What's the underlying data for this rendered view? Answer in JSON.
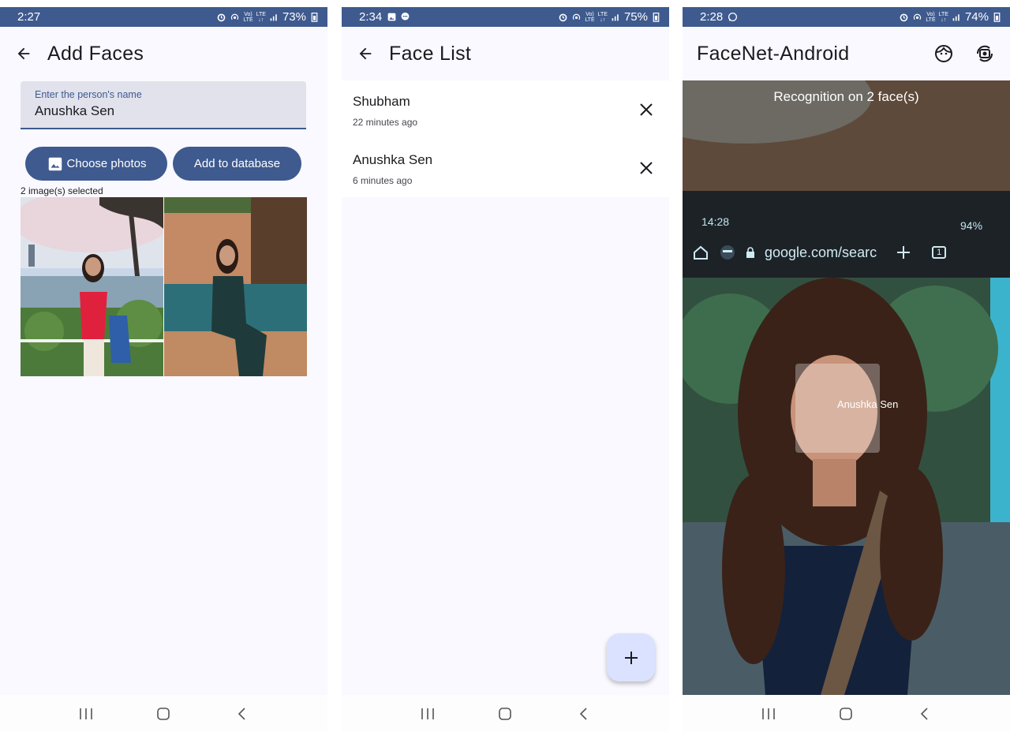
{
  "screen1": {
    "status": {
      "time": "2:27",
      "battery": "73%"
    },
    "title": "Add Faces",
    "name_field": {
      "label": "Enter the person's name",
      "value": "Anushka Sen"
    },
    "choose_label": "Choose photos",
    "add_label": "Add to database",
    "selected_text": "2 image(s) selected"
  },
  "screen2": {
    "status": {
      "time": "2:34",
      "battery": "75%"
    },
    "title": "Face List",
    "faces": [
      {
        "name": "Shubham",
        "ago": "22 minutes ago"
      },
      {
        "name": "Anushka Sen",
        "ago": "6 minutes ago"
      }
    ],
    "fab_icon": "add-icon"
  },
  "screen3": {
    "status": {
      "time": "2:28",
      "battery": "74%"
    },
    "title": "FaceNet-Android",
    "recognition_text": "Recognition on 2 face(s)",
    "face_label": "Anushka Sen",
    "inner_phone": {
      "time": "14:28",
      "battery": "94%",
      "url": "google.com/searc",
      "tabs": "1"
    }
  },
  "colors": {
    "primary": "#3e5a8e",
    "surface": "#f9f9ff",
    "field": "#e1e2ec",
    "fab": "#dae2ff"
  }
}
